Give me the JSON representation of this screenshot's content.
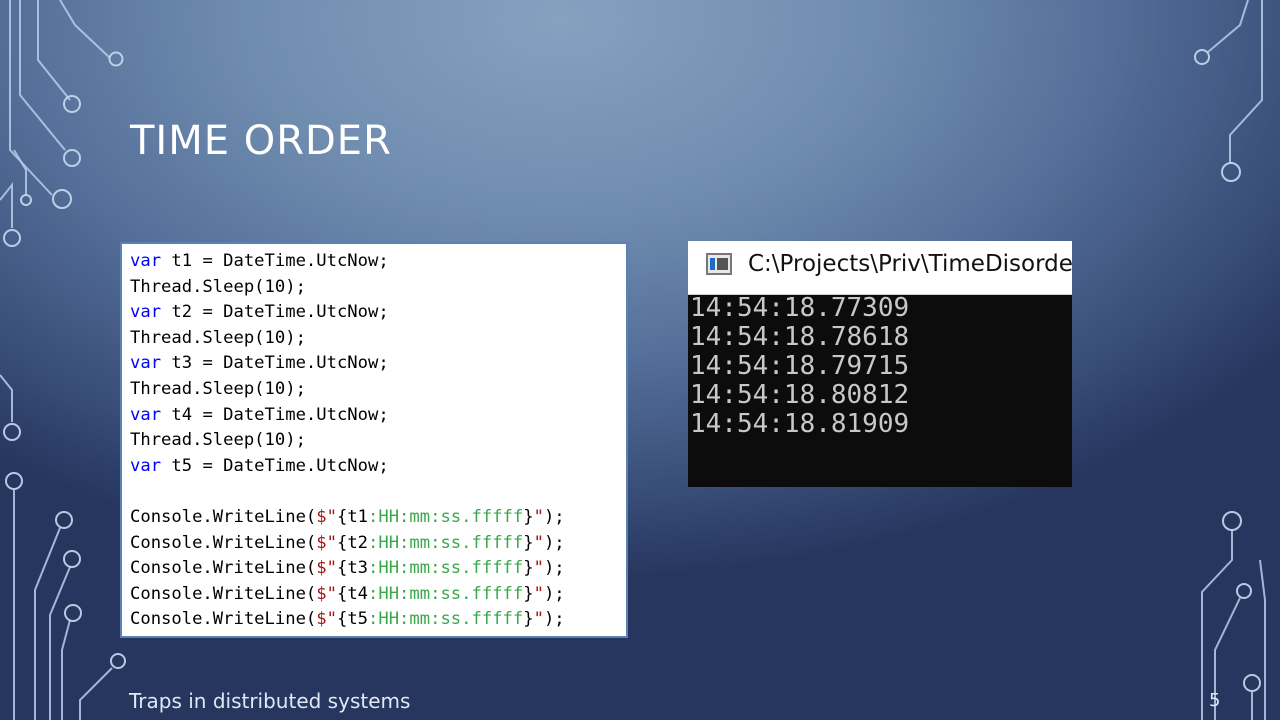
{
  "slide": {
    "title": "TIME ORDER",
    "footer": "Traps in distributed systems",
    "page_number": "5"
  },
  "code": {
    "lines": [
      [
        {
          "t": "kw",
          "v": "var"
        },
        {
          "t": "plain",
          "v": " t1 = DateTime.UtcNow;"
        }
      ],
      [
        {
          "t": "plain",
          "v": "Thread.Sleep(10);"
        }
      ],
      [
        {
          "t": "kw",
          "v": "var"
        },
        {
          "t": "plain",
          "v": " t2 = DateTime.UtcNow;"
        }
      ],
      [
        {
          "t": "plain",
          "v": "Thread.Sleep(10);"
        }
      ],
      [
        {
          "t": "kw",
          "v": "var"
        },
        {
          "t": "plain",
          "v": " t3 = DateTime.UtcNow;"
        }
      ],
      [
        {
          "t": "plain",
          "v": "Thread.Sleep(10);"
        }
      ],
      [
        {
          "t": "kw",
          "v": "var"
        },
        {
          "t": "plain",
          "v": " t4 = DateTime.UtcNow;"
        }
      ],
      [
        {
          "t": "plain",
          "v": "Thread.Sleep(10);"
        }
      ],
      [
        {
          "t": "kw",
          "v": "var"
        },
        {
          "t": "plain",
          "v": " t5 = DateTime.UtcNow;"
        }
      ],
      [],
      [
        {
          "t": "plain",
          "v": "Console.WriteLine("
        },
        {
          "t": "str",
          "v": "$\""
        },
        {
          "t": "plain",
          "v": "{t1"
        },
        {
          "t": "fmt",
          "v": ":HH:mm:ss.fffff"
        },
        {
          "t": "plain",
          "v": "}"
        },
        {
          "t": "str",
          "v": "\""
        },
        {
          "t": "plain",
          "v": ");"
        }
      ],
      [
        {
          "t": "plain",
          "v": "Console.WriteLine("
        },
        {
          "t": "str",
          "v": "$\""
        },
        {
          "t": "plain",
          "v": "{t2"
        },
        {
          "t": "fmt",
          "v": ":HH:mm:ss.fffff"
        },
        {
          "t": "plain",
          "v": "}"
        },
        {
          "t": "str",
          "v": "\""
        },
        {
          "t": "plain",
          "v": ");"
        }
      ],
      [
        {
          "t": "plain",
          "v": "Console.WriteLine("
        },
        {
          "t": "str",
          "v": "$\""
        },
        {
          "t": "plain",
          "v": "{t3"
        },
        {
          "t": "fmt",
          "v": ":HH:mm:ss.fffff"
        },
        {
          "t": "plain",
          "v": "}"
        },
        {
          "t": "str",
          "v": "\""
        },
        {
          "t": "plain",
          "v": ");"
        }
      ],
      [
        {
          "t": "plain",
          "v": "Console.WriteLine("
        },
        {
          "t": "str",
          "v": "$\""
        },
        {
          "t": "plain",
          "v": "{t4"
        },
        {
          "t": "fmt",
          "v": ":HH:mm:ss.fffff"
        },
        {
          "t": "plain",
          "v": "}"
        },
        {
          "t": "str",
          "v": "\""
        },
        {
          "t": "plain",
          "v": ");"
        }
      ],
      [
        {
          "t": "plain",
          "v": "Console.WriteLine("
        },
        {
          "t": "str",
          "v": "$\""
        },
        {
          "t": "plain",
          "v": "{t5"
        },
        {
          "t": "fmt",
          "v": ":HH:mm:ss.fffff"
        },
        {
          "t": "plain",
          "v": "}"
        },
        {
          "t": "str",
          "v": "\""
        },
        {
          "t": "plain",
          "v": ");"
        }
      ]
    ]
  },
  "console": {
    "icon": "console-app-icon",
    "title": "C:\\Projects\\Priv\\TimeDisorder",
    "output": [
      "14:54:18.77309",
      "14:54:18.78618",
      "14:54:18.79715",
      "14:54:18.80812",
      "14:54:18.81909"
    ]
  },
  "colors": {
    "keyword": "#0000ff",
    "string": "#a31515",
    "format": "#3aa84a",
    "console_bg": "#0c0c0c",
    "console_text": "#c8c8c8"
  }
}
